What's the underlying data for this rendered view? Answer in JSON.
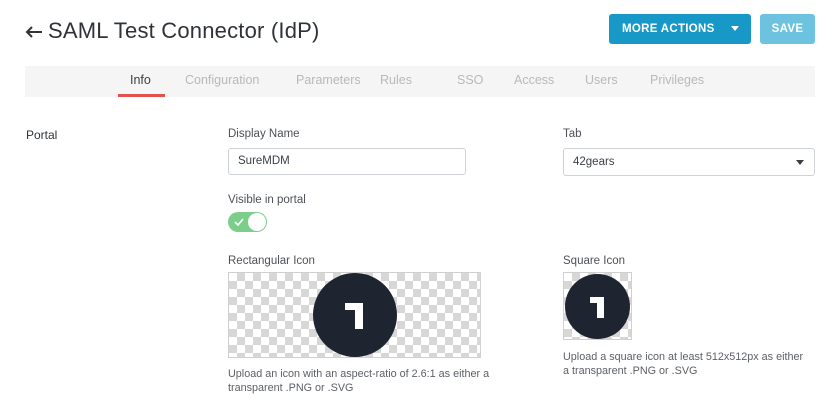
{
  "header": {
    "title": "SAML Test Connector (IdP)",
    "more_actions_label": "MORE ACTIONS",
    "save_label": "SAVE"
  },
  "tabs": [
    {
      "label": "Info",
      "active": true
    },
    {
      "label": "Configuration",
      "active": false
    },
    {
      "label": "Parameters",
      "active": false
    },
    {
      "label": "Rules",
      "active": false
    },
    {
      "label": "SSO",
      "active": false
    },
    {
      "label": "Access",
      "active": false
    },
    {
      "label": "Users",
      "active": false
    },
    {
      "label": "Privileges",
      "active": false
    }
  ],
  "portal": {
    "section_label": "Portal",
    "display_name_label": "Display Name",
    "display_name_value": "SureMDM",
    "tab_label": "Tab",
    "tab_value": "42gears",
    "visible_label": "Visible in portal",
    "visible_on": true,
    "rect_icon_label": "Rectangular Icon",
    "rect_icon_help": "Upload an icon with an aspect-ratio of 2.6:1 as either a transparent .PNG or .SVG",
    "square_icon_label": "Square Icon",
    "square_icon_help": "Upload a square icon at least 512x512px as either a transparent .PNG or .SVG"
  },
  "colors": {
    "primary": "#1798c6",
    "save_disabled": "#6cc2df",
    "tab_active_underline": "#e3514d",
    "toggle_on": "#7ccf8b",
    "icon_dark": "#1f2530"
  }
}
